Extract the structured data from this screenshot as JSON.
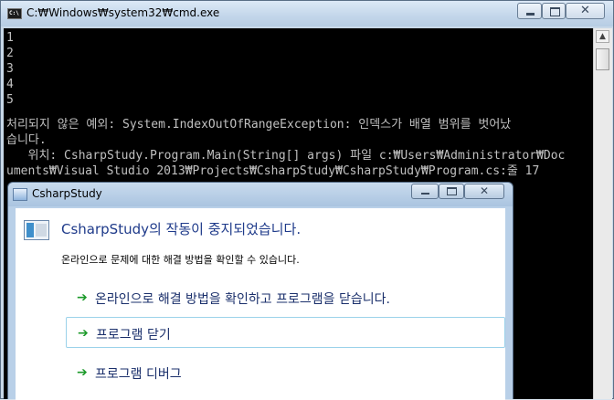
{
  "cmd": {
    "title": "C:₩Windows₩system32₩cmd.exe",
    "icon_text": "C:\\",
    "controls": {
      "minimize": "minimize-icon",
      "maximize": "maximize-icon",
      "close": "✕"
    },
    "lines": [
      "1",
      "2",
      "3",
      "4",
      "5",
      "",
      "처리되지 않은 예외: System.IndexOutOfRangeException: 인덱스가 배열 범위를 벗어났",
      "습니다.",
      "   위치: CsharpStudy.Program.Main(String[] args) 파일 c:₩Users₩Administrator₩Doc",
      "uments₩Visual Studio 2013₩Projects₩CsharpStudy₩CsharpStudy₩Program.cs:줄 17"
    ],
    "scroll_up": "▲"
  },
  "dialog": {
    "title": "CsharpStudy",
    "close_glyph": "✕",
    "heading": "CsharpStudy의 작동이 중지되었습니다.",
    "subtitle": "온라인으로 문제에 대한 해결 방법을 확인할 수 있습니다.",
    "arrow": "➔",
    "options": [
      {
        "label": "온라인으로 해결 방법을 확인하고 프로그램을 닫습니다."
      },
      {
        "label": "프로그램 닫기"
      },
      {
        "label": "프로그램 디버그"
      }
    ]
  },
  "colors": {
    "heading": "#1e3a8a",
    "option_text": "#1a2f6b",
    "arrow": "#1c9a2a",
    "console_text": "#c0c0c0"
  }
}
